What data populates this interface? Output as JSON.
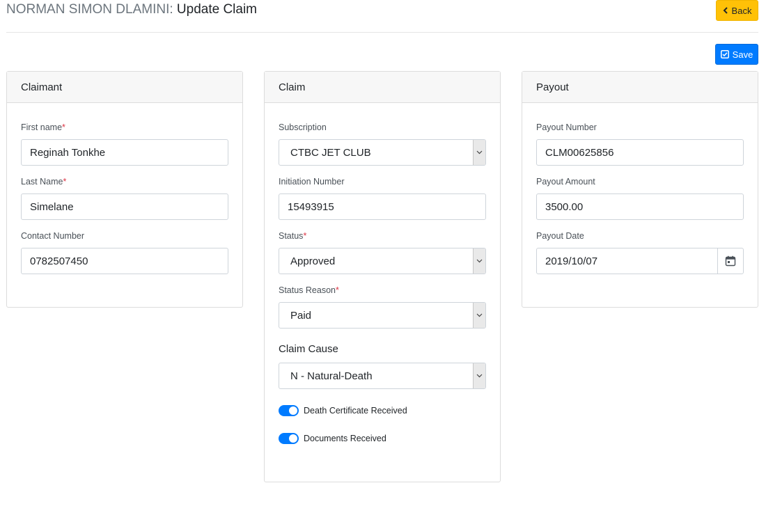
{
  "header": {
    "person_name": "NORMAN SIMON DLAMINI:",
    "action_title": "Update Claim",
    "back_label": "Back",
    "save_label": "Save"
  },
  "claimant": {
    "title": "Claimant",
    "first_name": {
      "label": "First name",
      "required": "*",
      "value": "Reginah Tonkhe"
    },
    "last_name": {
      "label": "Last Name",
      "required": "*",
      "value": "Simelane"
    },
    "contact_number": {
      "label": "Contact Number",
      "value": "0782507450"
    }
  },
  "claim": {
    "title": "Claim",
    "subscription": {
      "label": "Subscription",
      "value": "CTBC JET CLUB"
    },
    "initiation_number": {
      "label": "Initiation Number",
      "value": "15493915"
    },
    "status": {
      "label": "Status",
      "required": "*",
      "value": "Approved"
    },
    "status_reason": {
      "label": "Status Reason",
      "required": "*",
      "value": "Paid"
    },
    "claim_cause": {
      "label": "Claim Cause",
      "value": "N - Natural-Death"
    },
    "toggles": [
      {
        "label": "Death Certificate Received",
        "on": true
      },
      {
        "label": "Documents Received",
        "on": true
      }
    ]
  },
  "payout": {
    "title": "Payout",
    "payout_number": {
      "label": "Payout Number",
      "value": "CLM00625856"
    },
    "payout_amount": {
      "label": "Payout Amount",
      "value": "3500.00"
    },
    "payout_date": {
      "label": "Payout Date",
      "value": "2019/10/07"
    }
  },
  "colors": {
    "primary": "#007bff",
    "warning": "#ffc107",
    "required": "#dc3545"
  },
  "icons": {
    "back": "chevron-left-icon",
    "save": "checkbox-icon",
    "select": "chevron-down-icon",
    "date": "calendar-icon"
  }
}
